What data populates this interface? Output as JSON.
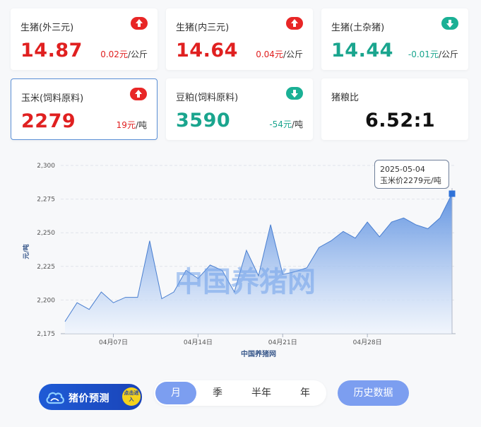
{
  "cards": [
    {
      "name": "生猪(外三元)",
      "price": "14.87",
      "change": "0.02元",
      "unit": "/公斤",
      "trend": "up"
    },
    {
      "name": "生猪(内三元)",
      "price": "14.64",
      "change": "0.04元",
      "unit": "/公斤",
      "trend": "up"
    },
    {
      "name": "生猪(土杂猪)",
      "price": "14.44",
      "change": "-0.01元",
      "unit": "/公斤",
      "trend": "down"
    },
    {
      "name": "玉米(饲料原料)",
      "price": "2279",
      "change": "19元",
      "unit": "/吨",
      "trend": "up"
    },
    {
      "name": "豆粕(饲料原料)",
      "price": "3590",
      "change": "-54元",
      "unit": "/吨",
      "trend": "down"
    },
    {
      "name": "猪粮比",
      "price": "6.52:1"
    }
  ],
  "chart_data": {
    "type": "area",
    "ylabel": "元/吨",
    "xlabel": "中国养猪网",
    "watermark": "中国养猪网",
    "ylim": [
      2175,
      2300
    ],
    "yticks": [
      "2,175",
      "2,200",
      "2,225",
      "2,250",
      "2,275",
      "2,300"
    ],
    "xticks": [
      "04月07日",
      "04月14日",
      "04月21日",
      "04月28日"
    ],
    "grid": true,
    "x": [
      "2025-04-03",
      "2025-04-04",
      "2025-04-05",
      "2025-04-06",
      "2025-04-07",
      "2025-04-08",
      "2025-04-09",
      "2025-04-10",
      "2025-04-11",
      "2025-04-12",
      "2025-04-13",
      "2025-04-14",
      "2025-04-15",
      "2025-04-16",
      "2025-04-17",
      "2025-04-18",
      "2025-04-19",
      "2025-04-20",
      "2025-04-21",
      "2025-04-22",
      "2025-04-23",
      "2025-04-24",
      "2025-04-25",
      "2025-04-26",
      "2025-04-27",
      "2025-04-28",
      "2025-04-29",
      "2025-04-30",
      "2025-05-01",
      "2025-05-02",
      "2025-05-03",
      "2025-05-04"
    ],
    "series": [
      {
        "values": [
          2184,
          2198,
          2193,
          2206,
          2198,
          2202,
          2202,
          2244,
          2201,
          2206,
          2222,
          2216,
          2226,
          2222,
          2206,
          2237,
          2218,
          2256,
          2219,
          2221,
          2224,
          2239,
          2244,
          2251,
          2246,
          2258,
          2247,
          2258,
          2261,
          2256,
          2253,
          2261,
          2279
        ]
      }
    ],
    "tooltip": {
      "date": "2025-05-04",
      "text": "玉米价2279元/吨"
    },
    "colors": {
      "area_top": "#5a8fe0",
      "area_bottom": "#eef4fd",
      "line": "#4a7fd0",
      "marker": "#2f72d8"
    }
  },
  "controls": {
    "forecast_label": "猪价预测",
    "forecast_badge": "点击进入",
    "periods": [
      "月",
      "季",
      "半年",
      "年"
    ],
    "active_period": "月",
    "history_label": "历史数据"
  }
}
